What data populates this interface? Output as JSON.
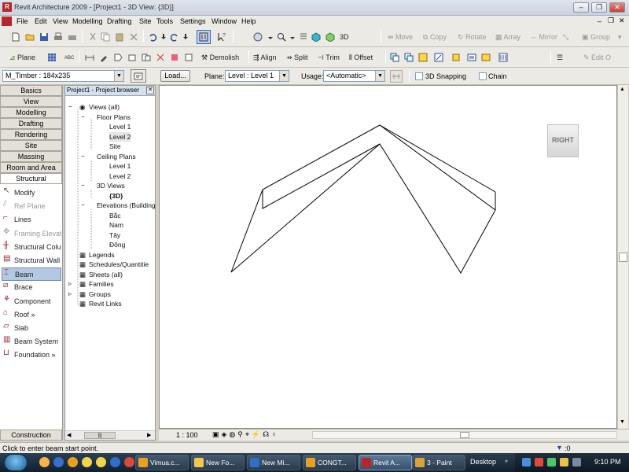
{
  "window": {
    "title": "Revit Architecture 2009 - [Project1 - 3D View: {3D}]",
    "app_icon_text": "R"
  },
  "menu": [
    "File",
    "Edit",
    "View",
    "Modelling",
    "Drafting",
    "Site",
    "Tools",
    "Settings",
    "Window",
    "Help"
  ],
  "toolbar1": {
    "view3d_label": "3D",
    "move": "Move",
    "copy": "Copy",
    "rotate": "Rotate",
    "array": "Array",
    "mirror": "Mirror",
    "group": "Group"
  },
  "toolbar2": {
    "plane": "Plane",
    "demolish": "Demolish",
    "align": "Align",
    "split": "Split",
    "trim": "Trim",
    "offset": "Offset",
    "edit": "Edit O"
  },
  "options_bar": {
    "type_value": "M_Timber : 184x235",
    "load_button": "Load...",
    "plane_label": "Plane:",
    "plane_value": "Level : Level 1",
    "usage_label": "Usage:",
    "usage_value": "<Automatic>",
    "snapping_label": "3D Snapping",
    "chain_label": "Chain"
  },
  "design_bar": {
    "tabs": [
      "Basics",
      "View",
      "Modelling",
      "Drafting",
      "Rendering",
      "Site",
      "Massing",
      "Room and Area",
      "Structural"
    ],
    "items": [
      {
        "label": "Modify",
        "icon": "cursor-icon",
        "enabled": true,
        "selected": false
      },
      {
        "label": "Ref Plane",
        "icon": "ref-plane-icon",
        "enabled": false,
        "selected": false
      },
      {
        "label": "Lines",
        "icon": "lines-icon",
        "enabled": true,
        "selected": false
      },
      {
        "label": "Framing Elevati",
        "icon": "framing-elevation-icon",
        "enabled": false,
        "selected": false
      },
      {
        "label": "Structural Colu",
        "icon": "structural-column-icon",
        "enabled": true,
        "selected": false
      },
      {
        "label": "Structural Wall",
        "icon": "structural-wall-icon",
        "enabled": true,
        "selected": false
      },
      {
        "label": "Beam",
        "icon": "beam-icon",
        "enabled": true,
        "selected": true
      },
      {
        "label": "Brace",
        "icon": "brace-icon",
        "enabled": true,
        "selected": false
      },
      {
        "label": "Component",
        "icon": "component-icon",
        "enabled": true,
        "selected": false
      },
      {
        "label": "Roof »",
        "icon": "roof-icon",
        "enabled": true,
        "selected": false
      },
      {
        "label": "Slab",
        "icon": "slab-icon",
        "enabled": true,
        "selected": false
      },
      {
        "label": "Beam System",
        "icon": "beam-system-icon",
        "enabled": true,
        "selected": false
      },
      {
        "label": "Foundation »",
        "icon": "foundation-icon",
        "enabled": true,
        "selected": false
      }
    ],
    "bottom_tab": "Construction"
  },
  "project_browser": {
    "title": "Project1 - Project browser",
    "tree": [
      {
        "label": "Views (all)",
        "level": 0,
        "expander": "-",
        "icon": "eye-icon"
      },
      {
        "label": "Floor Plans",
        "level": 1,
        "expander": "-"
      },
      {
        "label": "Level 1",
        "level": 2
      },
      {
        "label": "Level 2",
        "level": 2,
        "selected": true
      },
      {
        "label": "Site",
        "level": 2
      },
      {
        "label": "Ceiling Plans",
        "level": 1,
        "expander": "-"
      },
      {
        "label": "Level 1",
        "level": 2
      },
      {
        "label": "Level 2",
        "level": 2
      },
      {
        "label": "3D Views",
        "level": 1,
        "expander": "-"
      },
      {
        "label": "{3D}",
        "level": 2,
        "bold": true
      },
      {
        "label": "Elevations (Building",
        "level": 1,
        "expander": "-"
      },
      {
        "label": "Bắc",
        "level": 2
      },
      {
        "label": "Nam",
        "level": 2
      },
      {
        "label": "Tây",
        "level": 2
      },
      {
        "label": "Đông",
        "level": 2
      },
      {
        "label": "Legends",
        "level": 0,
        "icon": "legend-icon"
      },
      {
        "label": "Schedules/Quantitie",
        "level": 0,
        "icon": "schedule-icon"
      },
      {
        "label": "Sheets (all)",
        "level": 0,
        "icon": "sheet-icon"
      },
      {
        "label": "Families",
        "level": 0,
        "expander": "+",
        "icon": "families-icon"
      },
      {
        "label": "Groups",
        "level": 0,
        "expander": "+",
        "icon": "groups-icon"
      },
      {
        "label": "Revit Links",
        "level": 0,
        "icon": "revit-links-icon"
      }
    ]
  },
  "viewcube": {
    "face": "RIGHT"
  },
  "view_bar": {
    "scale": "1 : 100"
  },
  "status": {
    "message": "Click to enter beam start point.",
    "filter_count": ":0"
  },
  "taskbar": {
    "items": [
      {
        "label": "Vimua.c...",
        "color": "#e8a020",
        "icon": "chrome-icon"
      },
      {
        "label": "New Fo...",
        "color": "#f2c84b",
        "icon": "folder-icon"
      },
      {
        "label": "New Mi...",
        "color": "#2f6fc9",
        "icon": "word-icon"
      },
      {
        "label": "CONGT...",
        "color": "#e8a020",
        "icon": "chrome-icon"
      },
      {
        "label": "Revit A...",
        "color": "#b8252b",
        "icon": "revit-icon",
        "active": true
      },
      {
        "label": "3 - Paint",
        "color": "#d9a33a",
        "icon": "paint-icon"
      }
    ],
    "desktop": "Desktop",
    "time": "9:10 PM"
  }
}
